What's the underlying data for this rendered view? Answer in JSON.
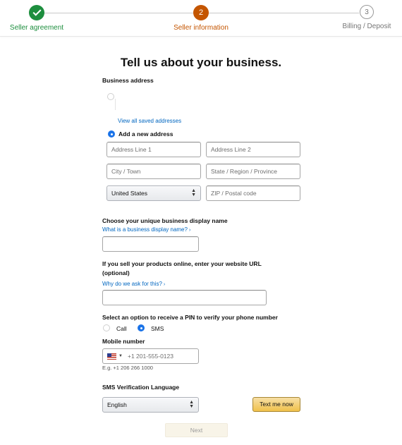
{
  "stepper": {
    "steps": [
      {
        "label": "Seller agreement",
        "status": "done",
        "number": ""
      },
      {
        "label": "Seller information",
        "status": "active",
        "number": "2"
      },
      {
        "label": "Billing / Deposit",
        "status": "todo",
        "number": "3"
      }
    ]
  },
  "title": "Tell us about your business.",
  "address": {
    "label": "Business address",
    "saved_link": "View all saved addresses",
    "new_address_label": "Add a new address",
    "line1_placeholder": "Address Line 1",
    "line2_placeholder": "Address Line 2",
    "city_placeholder": "City / Town",
    "state_placeholder": "State / Region / Province",
    "country_value": "United States",
    "zip_placeholder": "ZIP / Postal code"
  },
  "display_name": {
    "label": "Choose your unique business display name",
    "help_link": "What is a business display name?",
    "value": ""
  },
  "website": {
    "label_line1": "If you sell your products online, enter your website URL",
    "label_line2": "(optional)",
    "help_link": "Why do we ask for this?",
    "value": ""
  },
  "pin": {
    "label": "Select an option to receive a PIN to verify your phone number",
    "option_call": "Call",
    "option_sms": "SMS",
    "selected": "SMS"
  },
  "mobile": {
    "label": "Mobile number",
    "country_flag": "us-flag-icon",
    "placeholder": "+1 201-555-0123",
    "example": "E.g. +1 206 266 1000"
  },
  "sms_language": {
    "label": "SMS Verification Language",
    "value": "English",
    "text_me_button": "Text me now"
  },
  "next_button": "Next",
  "colors": {
    "done_green": "#1d8e3e",
    "active_orange": "#c45500",
    "link_blue": "#0066c0",
    "radio_blue": "#1a73e8",
    "button_yellow": "#f0c14b"
  }
}
